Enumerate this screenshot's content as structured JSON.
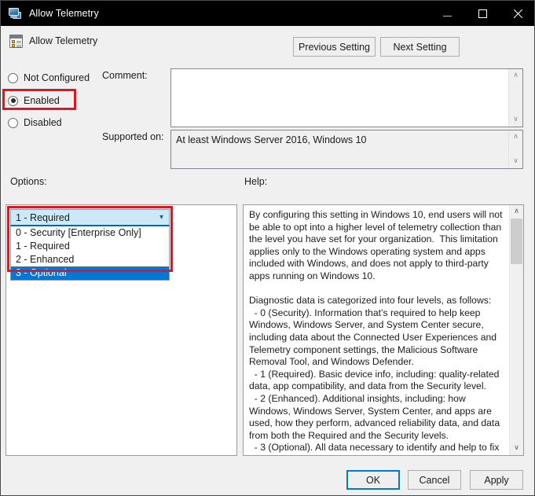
{
  "window": {
    "title": "Allow Telemetry",
    "icon": "monitor-policy-icon",
    "minimize_label": "—",
    "maximize_label": "□",
    "close_label": "✕"
  },
  "header": {
    "setting_title": "Allow Telemetry",
    "previous_setting_label": "Previous Setting",
    "next_setting_label": "Next Setting"
  },
  "state": {
    "not_configured_label": "Not Configured",
    "enabled_label": "Enabled",
    "disabled_label": "Disabled",
    "selected": "Enabled"
  },
  "fields": {
    "comment_label": "Comment:",
    "comment_value": "",
    "supported_label": "Supported on:",
    "supported_value": "At least Windows Server 2016, Windows 10"
  },
  "sections": {
    "options_label": "Options:",
    "help_label": "Help:"
  },
  "combobox": {
    "selected_value": "1 - Required",
    "caret_icon": "chevron-down-icon",
    "options": [
      "0 - Security [Enterprise Only]",
      "1 - Required",
      "2 - Enhanced",
      "3 - Optional"
    ],
    "highlighted_option": "3 - Optional"
  },
  "help": {
    "text": "By configuring this setting in Windows 10, end users will not be able to opt into a higher level of telemetry collection than the level you have set for your organization.  This limitation applies only to the Windows operating system and apps included with Windows, and does not apply to third-party apps running on Windows 10.\n\nDiagnostic data is categorized into four levels, as follows:\n  - 0 (Security). Information that’s required to help keep Windows, Windows Server, and System Center secure, including data about the Connected User Experiences and Telemetry component settings, the Malicious Software Removal Tool, and Windows Defender.\n  - 1 (Required). Basic device info, including: quality-related data, app compatibility, and data from the Security level.\n  - 2 (Enhanced). Additional insights, including: how Windows, Windows Server, System Center, and apps are used, how they perform, advanced reliability data, and data from both the Required and the Security levels.\n  - 3 (Optional). All data necessary to identify and help to fix problems, plus data from the Security, Required, and Enhanced"
  },
  "footer": {
    "ok_label": "OK",
    "cancel_label": "Cancel",
    "apply_label": "Apply"
  },
  "scrollbars": {
    "up_arrow": "∧",
    "down_arrow": "∨"
  },
  "colors": {
    "accent": "#0078d7",
    "highlight_outline": "#e8111c",
    "titlebar": "#000000",
    "dialog_bg": "#f0f0f0"
  }
}
